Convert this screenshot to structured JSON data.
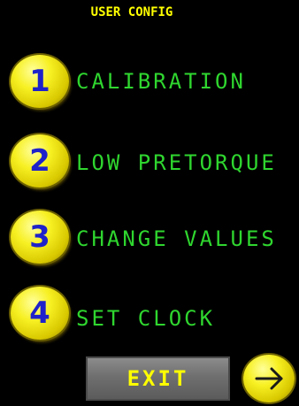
{
  "title": "USER CONFIG",
  "menu": [
    {
      "number": "1",
      "label": "CALIBRATION"
    },
    {
      "number": "2",
      "label": "LOW PRETORQUE"
    },
    {
      "number": "3",
      "label": "CHANGE VALUES"
    },
    {
      "number": "4",
      "label": "SET CLOCK"
    }
  ],
  "exit_label": "EXIT",
  "next_icon": "right-arrow-icon",
  "colors": {
    "background": "#000000",
    "title": "#ffff00",
    "label": "#2fd62f",
    "button": "#f7f022",
    "number": "#1f22c9",
    "exit_button": "#6f6f6f",
    "exit_text": "#ffff00"
  }
}
